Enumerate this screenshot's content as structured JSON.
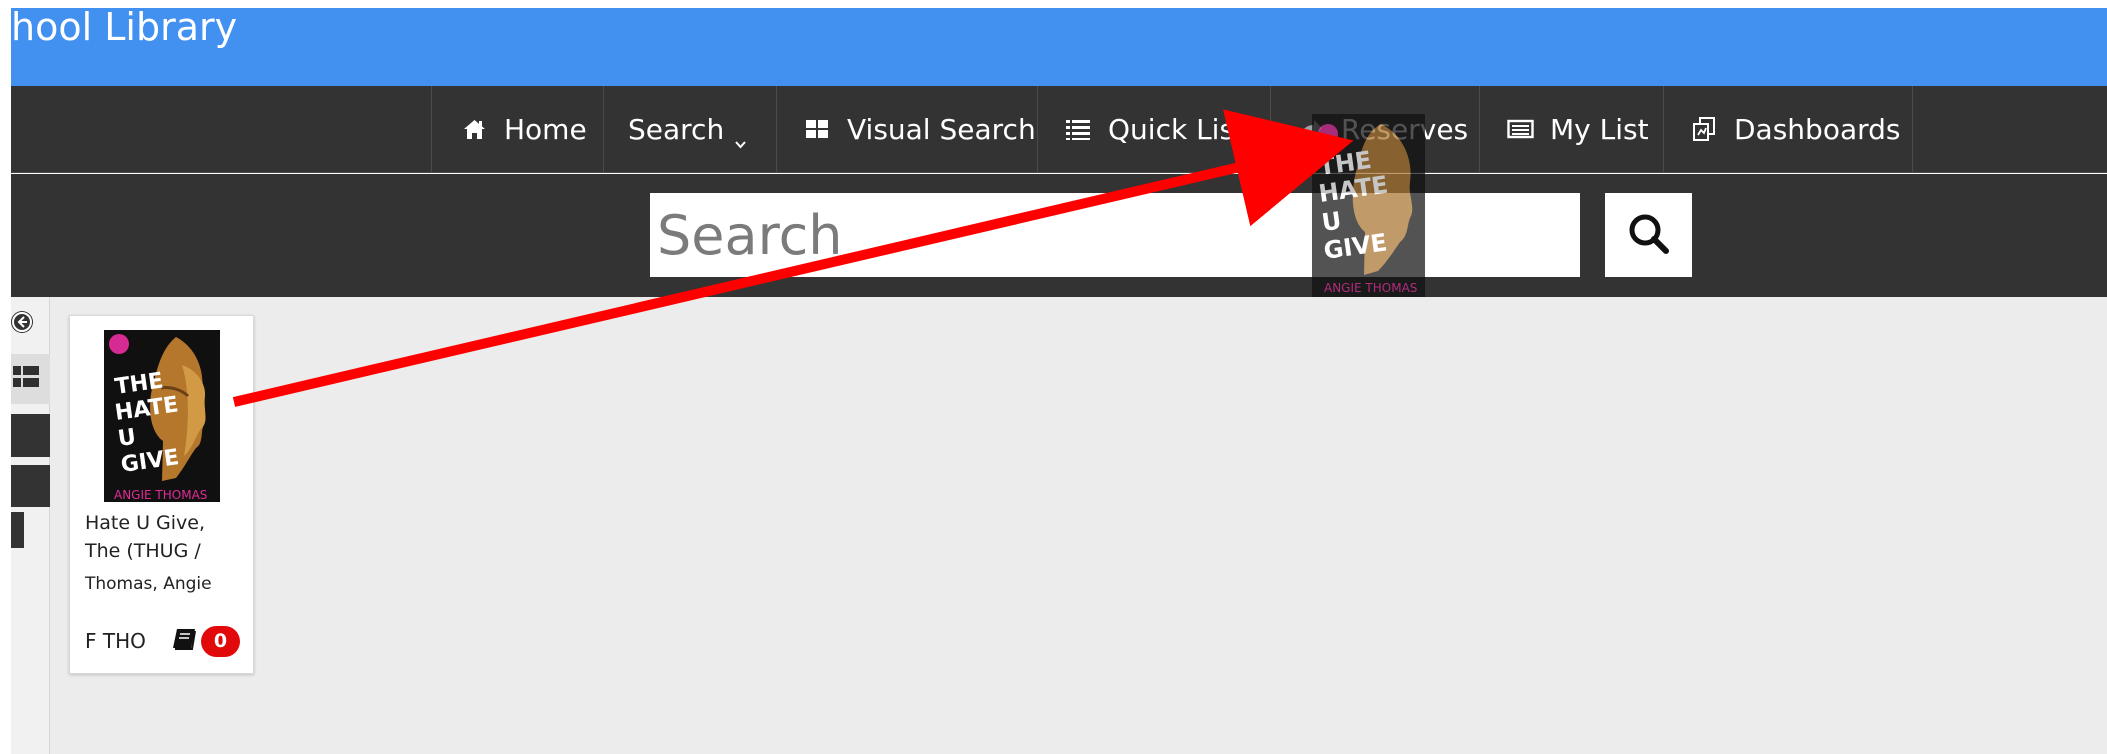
{
  "header": {
    "title": "hool Library"
  },
  "nav": {
    "home_label": "Home",
    "search_label": "Search",
    "visual_search_label": "Visual Search",
    "quick_lists_label": "Quick Lists",
    "reserves_label": "Reserves",
    "my_list_label": "My List",
    "dashboards_label": "Dashboards"
  },
  "search": {
    "placeholder": "Search"
  },
  "results": {
    "books": [
      {
        "title": "Hate U Give, The (THUG /",
        "author": "Thomas, Angie",
        "call_number": "F THO",
        "available_count": "0",
        "cover_title": "THE HATE U GIVE",
        "cover_author": "ANGIE THOMAS"
      }
    ]
  },
  "drag_preview": {
    "cover_title": "THE HATE U GIVE",
    "cover_author": "ANGIE THOMAS"
  },
  "colors": {
    "header_blue": "#4290f0",
    "nav_dark": "#333333",
    "content_bg": "#ececec",
    "badge_red": "#e10909",
    "arrow_red": "#ff0000"
  },
  "icons": {
    "home": "home-icon",
    "search_menu": "chevron-down-icon",
    "visual_search": "grid-icon",
    "quick_lists": "list-icon",
    "reserves": "share-icon",
    "my_list": "card-list-icon",
    "dashboards": "dashboard-icon",
    "search_button": "magnifier-icon",
    "book": "book-icon"
  }
}
